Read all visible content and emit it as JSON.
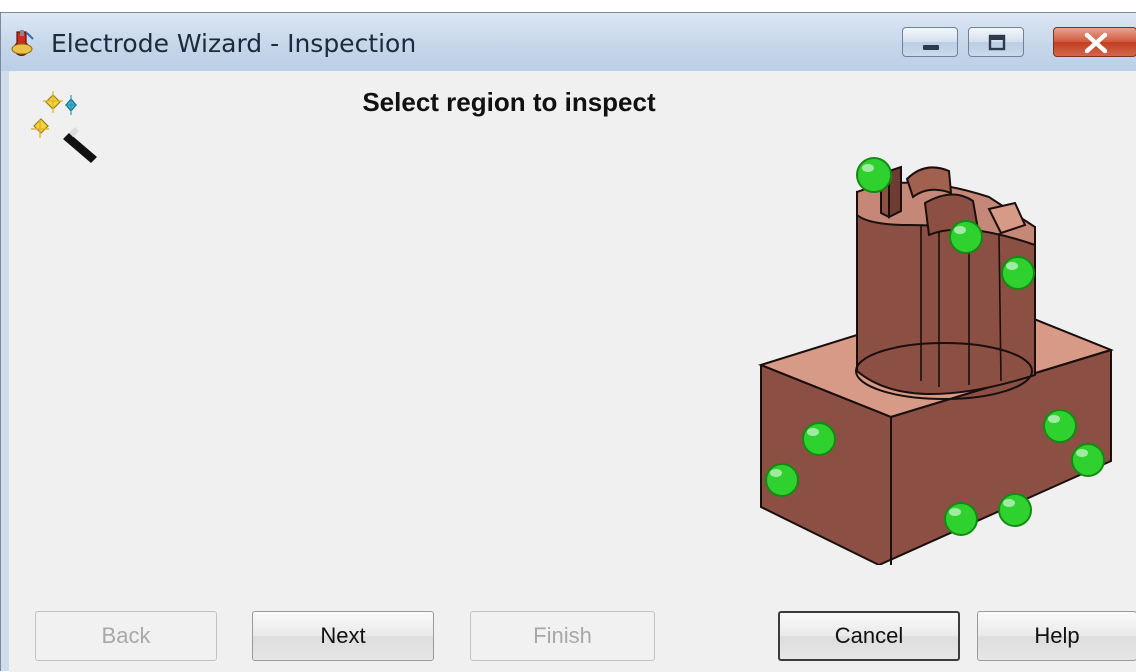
{
  "window": {
    "title": "Electrode Wizard - Inspection",
    "controls": [
      "minimize-icon",
      "maximize-icon",
      "close-icon"
    ]
  },
  "page": {
    "heading": "Select region to inspect"
  },
  "illustration": {
    "description_icon": "electrode-model-with-inspection-points",
    "point_color": "#2fd12f",
    "body_color": "#8a4e44"
  },
  "buttons": {
    "back": "Back",
    "next": "Next",
    "finish": "Finish",
    "cancel": "Cancel",
    "help": "Help"
  },
  "colors": {
    "accent_title": "#1f5fb0",
    "close_button": "#c9472a"
  }
}
